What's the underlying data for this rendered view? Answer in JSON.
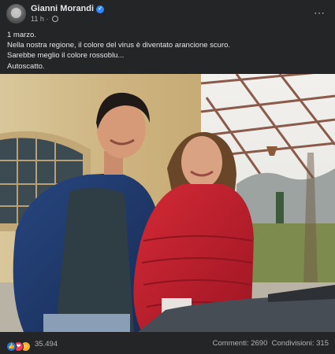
{
  "post": {
    "author": "Gianni Morandi",
    "time": "11 h",
    "separator": "·",
    "more_icon": "⋯",
    "verified_icon": "✓",
    "text_lines": [
      "1 marzo.",
      "Nella nostra regione, il colore del virus è diventato arancione scuro.",
      "Sarebbe meglio il colore rossoblu...",
      "Autoscatto."
    ]
  },
  "footer": {
    "reaction_icons": [
      "like-icon",
      "love-icon",
      "care-icon"
    ],
    "reaction_glyphs": [
      "👍",
      "❤",
      "☺"
    ],
    "reactions_count": "35.494",
    "comments": "Commenti: 2690",
    "shares": "Condivisioni: 315"
  },
  "colors": {
    "background": "#242526",
    "text": "#e4e6eb",
    "secondary": "#b0b3b8",
    "verified": "#2d88ff"
  }
}
